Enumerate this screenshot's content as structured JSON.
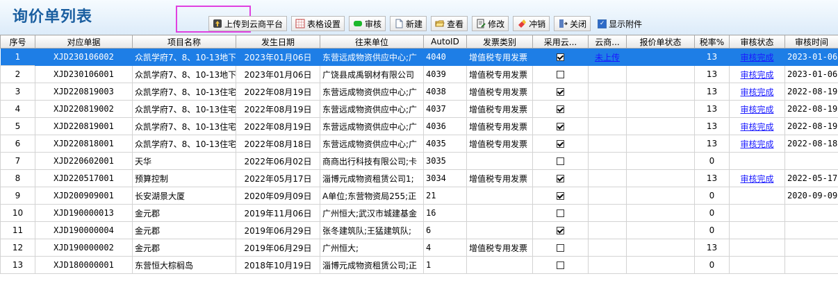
{
  "title": "询价单列表",
  "toolbar": {
    "upload": "上传到云商平台",
    "table_settings": "表格设置",
    "approve": "审核",
    "new": "新建",
    "view": "查看",
    "edit": "修改",
    "reverse": "冲销",
    "close": "关闭",
    "show_attach": "显示附件",
    "show_attach_checked": true
  },
  "columns": [
    "序号",
    "对应单据",
    "项目名称",
    "发生日期",
    "往来单位",
    "AutoID",
    "发票类别",
    "采用云...",
    "云商...",
    "报价单状态",
    "税率%",
    "审核状态",
    "审核时间"
  ],
  "rows": [
    {
      "seq": "1",
      "doc": "XJD230106002",
      "project": "众凯学府7、8、10-13地下",
      "date": "2023年01月06日",
      "partner": "东营远成物资供应中心;广",
      "autoid": "4040",
      "invoice": "增值税专用发票",
      "cloud": true,
      "yunshang": "未上传",
      "quote": "",
      "tax": "13",
      "audit": "审核完成",
      "audit_time": "2023-01-06"
    },
    {
      "seq": "2",
      "doc": "XJD230106001",
      "project": "众凯学府7、8、10-13地下",
      "date": "2023年01月06日",
      "partner": "广饶县成禹钢材有限公司",
      "autoid": "4039",
      "invoice": "增值税专用发票",
      "cloud": false,
      "yunshang": "",
      "quote": "",
      "tax": "13",
      "audit": "审核完成",
      "audit_time": "2023-01-06"
    },
    {
      "seq": "3",
      "doc": "XJD220819003",
      "project": "众凯学府7、8、10-13住宅",
      "date": "2022年08月19日",
      "partner": "东营远成物资供应中心;广",
      "autoid": "4038",
      "invoice": "增值税专用发票",
      "cloud": true,
      "yunshang": "",
      "quote": "",
      "tax": "13",
      "audit": "审核完成",
      "audit_time": "2022-08-19"
    },
    {
      "seq": "4",
      "doc": "XJD220819002",
      "project": "众凯学府7、8、10-13住宅",
      "date": "2022年08月19日",
      "partner": "东营远成物资供应中心;广",
      "autoid": "4037",
      "invoice": "增值税专用发票",
      "cloud": true,
      "yunshang": "",
      "quote": "",
      "tax": "13",
      "audit": "审核完成",
      "audit_time": "2022-08-19"
    },
    {
      "seq": "5",
      "doc": "XJD220819001",
      "project": "众凯学府7、8、10-13住宅",
      "date": "2022年08月19日",
      "partner": "东营远成物资供应中心;广",
      "autoid": "4036",
      "invoice": "增值税专用发票",
      "cloud": true,
      "yunshang": "",
      "quote": "",
      "tax": "13",
      "audit": "审核完成",
      "audit_time": "2022-08-19"
    },
    {
      "seq": "6",
      "doc": "XJD220818001",
      "project": "众凯学府7、8、10-13住宅",
      "date": "2022年08月18日",
      "partner": "东营远成物资供应中心;广",
      "autoid": "4035",
      "invoice": "增值税专用发票",
      "cloud": true,
      "yunshang": "",
      "quote": "",
      "tax": "13",
      "audit": "审核完成",
      "audit_time": "2022-08-18"
    },
    {
      "seq": "7",
      "doc": "XJD220602001",
      "project": "天华",
      "date": "2022年06月02日",
      "partner": "商商出行科技有限公司;卡",
      "autoid": "3035",
      "invoice": "",
      "cloud": false,
      "yunshang": "",
      "quote": "",
      "tax": "0",
      "audit": "",
      "audit_time": ""
    },
    {
      "seq": "8",
      "doc": "XJD220517001",
      "project": "预算控制",
      "date": "2022年05月17日",
      "partner": "淄博元成物资租赁公司1;",
      "autoid": "3034",
      "invoice": "增值税专用发票",
      "cloud": true,
      "yunshang": "",
      "quote": "",
      "tax": "13",
      "audit": "审核完成",
      "audit_time": "2022-05-17"
    },
    {
      "seq": "9",
      "doc": "XJD200909001",
      "project": "长安湖景大厦",
      "date": "2020年09月09日",
      "partner": "A单位;东营物资局255;正",
      "autoid": "21",
      "invoice": "",
      "cloud": true,
      "yunshang": "",
      "quote": "",
      "tax": "0",
      "audit": "",
      "audit_time": "2020-09-09"
    },
    {
      "seq": "10",
      "doc": "XJD190000013",
      "project": "金元郡",
      "date": "2019年11月06日",
      "partner": "广州恒大;武汉市城建基金",
      "autoid": "16",
      "invoice": "",
      "cloud": false,
      "yunshang": "",
      "quote": "",
      "tax": "0",
      "audit": "",
      "audit_time": ""
    },
    {
      "seq": "11",
      "doc": "XJD190000004",
      "project": "金元郡",
      "date": "2019年06月29日",
      "partner": "张冬建筑队;王猛建筑队;",
      "autoid": "6",
      "invoice": "",
      "cloud": true,
      "yunshang": "",
      "quote": "",
      "tax": "0",
      "audit": "",
      "audit_time": ""
    },
    {
      "seq": "12",
      "doc": "XJD190000002",
      "project": "金元郡",
      "date": "2019年06月29日",
      "partner": "广州恒大;",
      "autoid": "4",
      "invoice": "增值税专用发票",
      "cloud": false,
      "yunshang": "",
      "quote": "",
      "tax": "13",
      "audit": "",
      "audit_time": ""
    },
    {
      "seq": "13",
      "doc": "XJD180000001",
      "project": "东营恒大棕榈岛",
      "date": "2018年10月19日",
      "partner": "淄博元成物资租赁公司;正",
      "autoid": "1",
      "invoice": "",
      "cloud": false,
      "yunshang": "",
      "quote": "",
      "tax": "0",
      "audit": "",
      "audit_time": ""
    }
  ],
  "colors": {
    "selected_row": "#1e7ee6",
    "title": "#1b5fa0",
    "highlight_box": "#e040e0",
    "link": "#1a1aff"
  }
}
